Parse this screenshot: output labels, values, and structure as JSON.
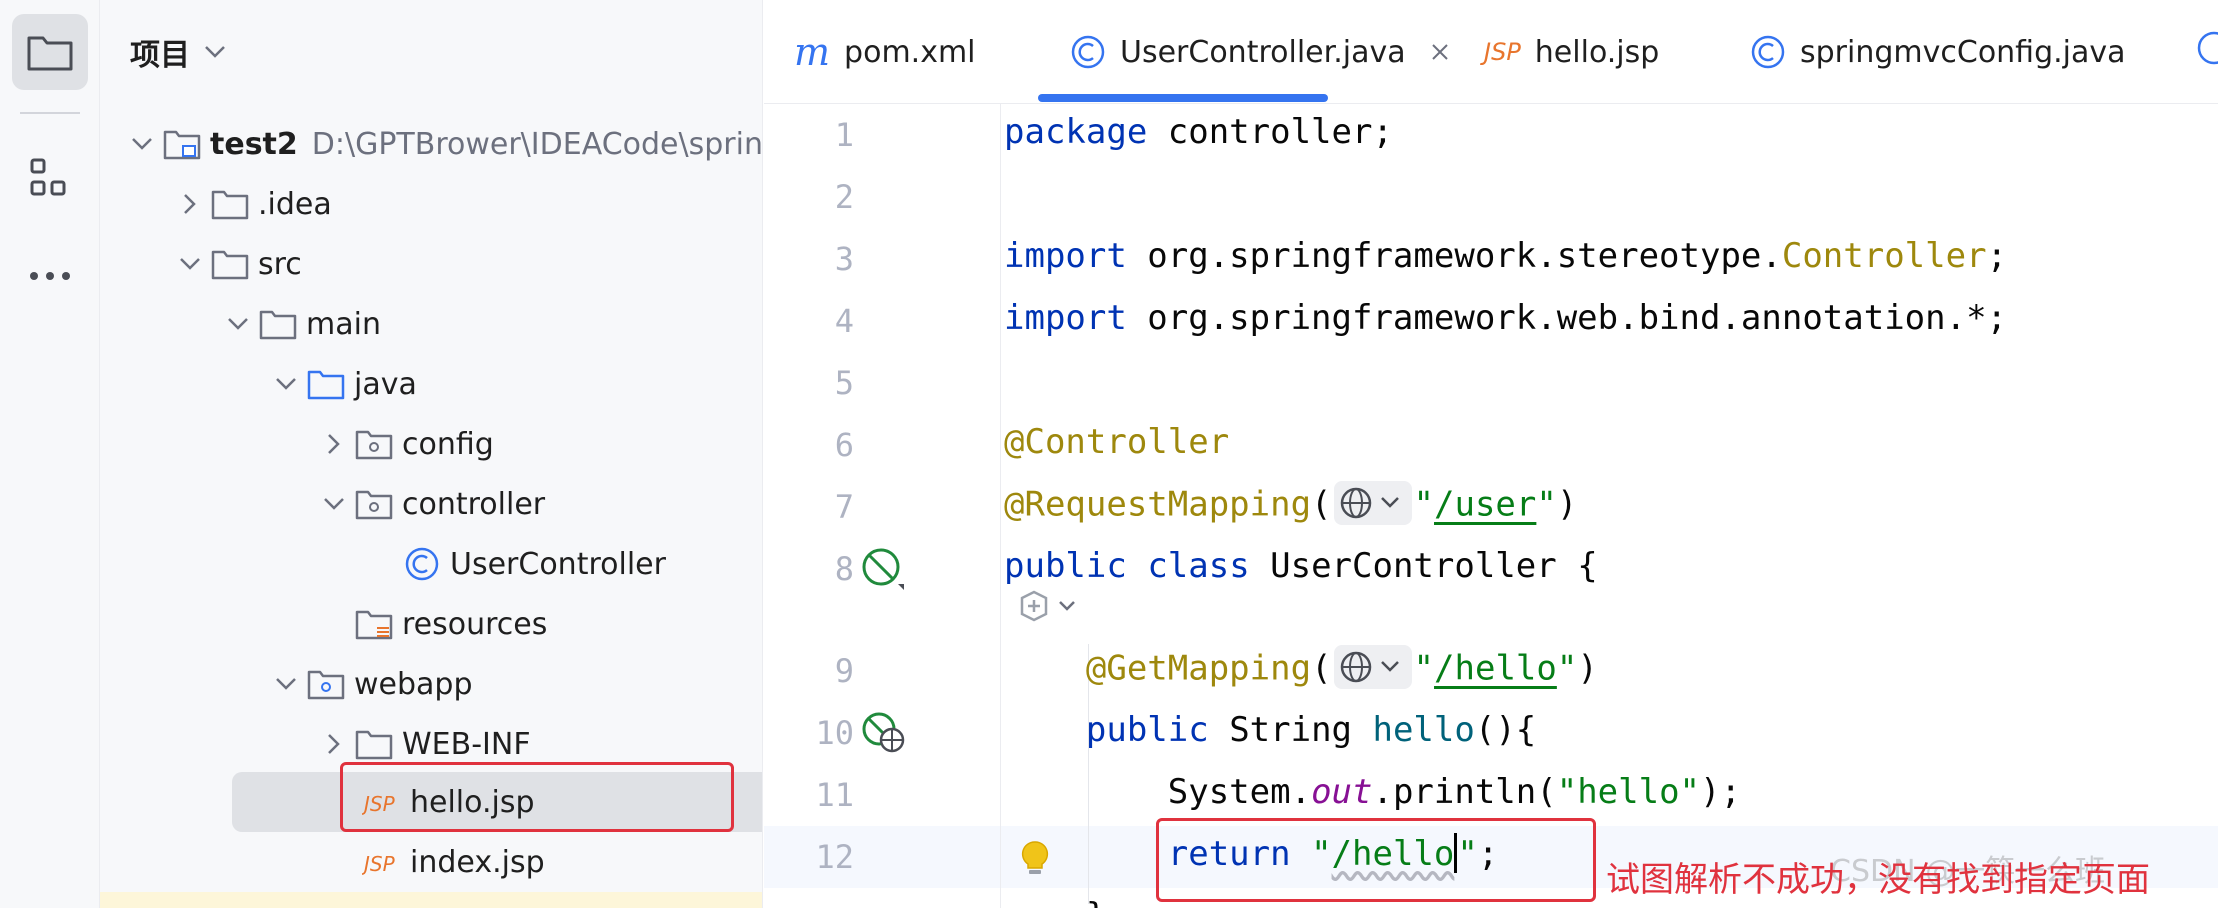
{
  "project": {
    "title": "项目",
    "tree": [
      {
        "label": "test2",
        "path": "D:\\GPTBrower\\IDEACode\\springb",
        "expanded": true,
        "icon": "module-folder-icon"
      },
      {
        "label": ".idea",
        "expanded": false,
        "icon": "folder-icon"
      },
      {
        "label": "src",
        "expanded": true,
        "icon": "folder-icon"
      },
      {
        "label": "main",
        "expanded": true,
        "icon": "folder-icon"
      },
      {
        "label": "java",
        "expanded": true,
        "icon": "source-root-folder-icon"
      },
      {
        "label": "config",
        "expanded": false,
        "icon": "package-icon"
      },
      {
        "label": "controller",
        "expanded": true,
        "icon": "package-icon"
      },
      {
        "label": "UserController",
        "icon": "class-icon"
      },
      {
        "label": "resources",
        "icon": "resources-folder-icon"
      },
      {
        "label": "webapp",
        "expanded": true,
        "icon": "web-folder-icon"
      },
      {
        "label": "WEB-INF",
        "expanded": false,
        "icon": "folder-icon"
      },
      {
        "label": "hello.jsp",
        "icon": "jsp-file-icon",
        "selected": true
      },
      {
        "label": "index.jsp",
        "icon": "jsp-file-icon"
      }
    ]
  },
  "tabs": [
    {
      "label": "pom.xml",
      "icon": "maven-icon",
      "icon_text": "m"
    },
    {
      "label": "UserController.java",
      "icon": "class-icon",
      "active": true
    },
    {
      "label": "hello.jsp",
      "icon": "jsp-file-icon",
      "icon_text": "JSP"
    },
    {
      "label": "springmvcConfig.java",
      "icon": "class-icon"
    }
  ],
  "editor": {
    "line_numbers": [
      "1",
      "2",
      "3",
      "4",
      "5",
      "6",
      "7",
      "8",
      "9",
      "10",
      "11",
      "12"
    ],
    "code": {
      "l1_kw": "package",
      "l1_rest": " controller;",
      "l3_kw": "import",
      "l3_rest": " org.springframework.stereotype.",
      "l3_cls": "Controller",
      "l3_end": ";",
      "l4_kw": "import",
      "l4_rest": " org.springframework.web.bind.annotation.*;",
      "l6_ann": "@Controller",
      "l7_ann": "@RequestMapping",
      "l7_open": "(",
      "l7_q1": "\"",
      "l7_path": "/user",
      "l7_q2": "\"",
      "l7_close": ")",
      "l8_kw1": "public",
      "l8_kw2": "class",
      "l8_rest": " UserController {",
      "l9_ann": "@GetMapping",
      "l9_open": "(",
      "l9_q1": "\"",
      "l9_path": "/hello",
      "l9_q2": "\"",
      "l9_close": ")",
      "l10_kw": "public",
      "l10_type": " String ",
      "l10_meth": "hello",
      "l10_rest": "(){",
      "l11_sys": "System.",
      "l11_field": "out",
      "l11_call": ".println(",
      "l11_str": "\"hello\"",
      "l11_end": ");",
      "l12_kw": "return",
      "l12_q1": " \"",
      "l12_str": "/hello",
      "l12_q2": "\"",
      "l12_end": ";"
    }
  },
  "annotation_text": "试图解析不成功，没有找到指定页面",
  "watermark": "CSDN @一筷一么班",
  "colors": {
    "highlight_box": "#e0323e",
    "accent": "#3574f0"
  }
}
